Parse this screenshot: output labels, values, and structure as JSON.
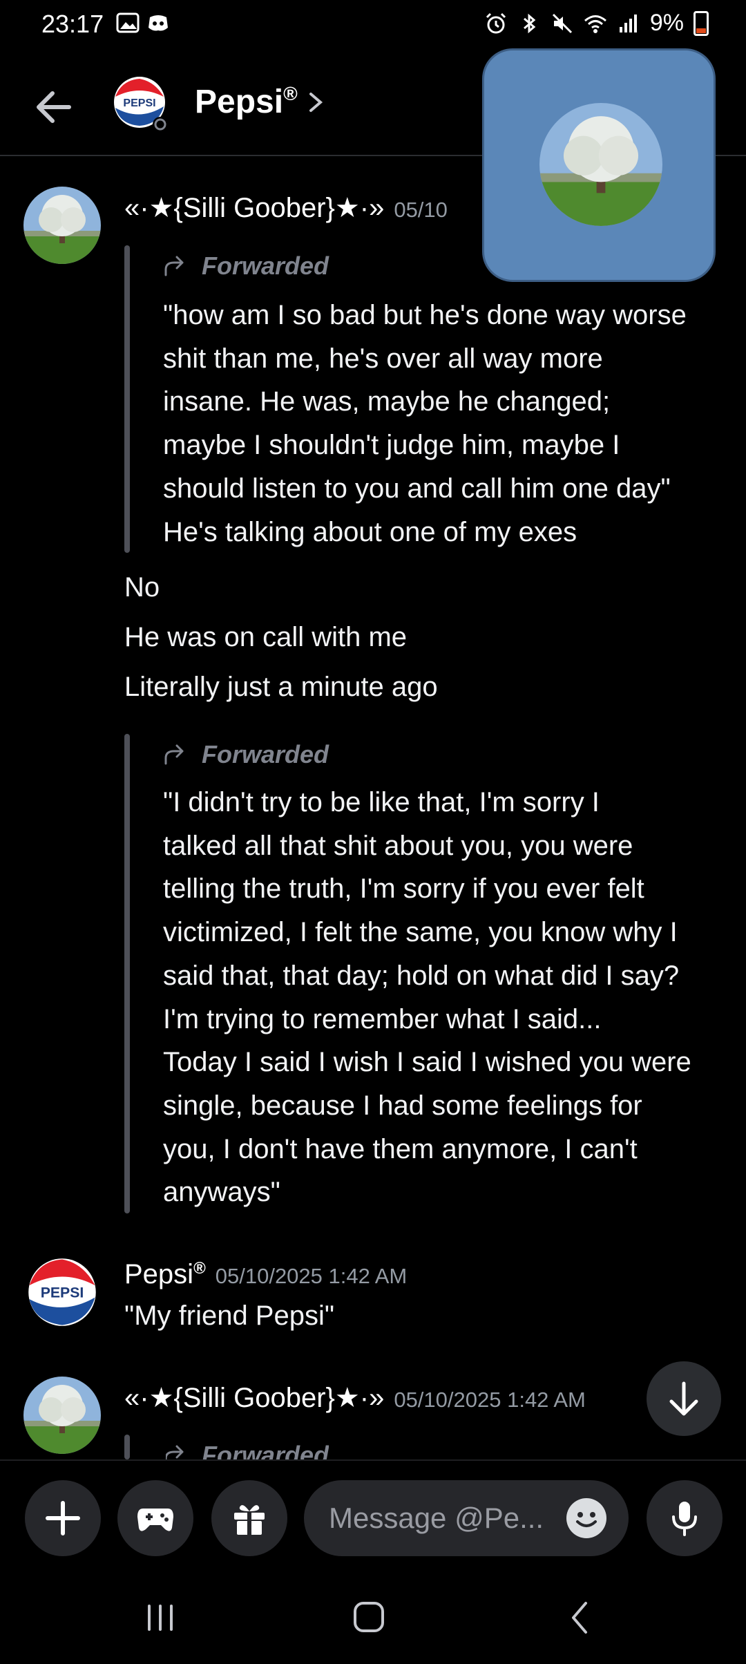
{
  "status_bar": {
    "time": "23:17",
    "battery": "9%"
  },
  "header": {
    "name": "Pepsi",
    "registered": "®",
    "avatar_logo_text": "PEPSI"
  },
  "messages": [
    {
      "author": "«·★{Silli Goober}★·»",
      "timestamp_partial": "05/10",
      "forwarded_label": "Forwarded",
      "forwarded_lines": [
        "\"how am I so bad but he's done way worse",
        "shit than me, he's over all way more",
        "insane. He was, maybe he changed;",
        "maybe I shouldn't judge him, maybe I",
        "should listen to you and call him one day\"",
        "He's talking about one of my exes"
      ],
      "plain_lines": [
        "No",
        "He was on call with me",
        "Literally just a minute ago"
      ],
      "forwarded2_label": "Forwarded",
      "forwarded2_lines": [
        "\"I didn't try to be like that, I'm sorry I",
        "talked all that shit about you, you were",
        "telling the truth, I'm sorry if you ever felt",
        "victimized, I felt the same, you know why I",
        "said that, that day; hold on what did I say?",
        "I'm trying to remember what I said...",
        "Today I said I wish I said I wished you were",
        "single, because I had some feelings for",
        "you, I don't have them anymore, I can't",
        "anyways\""
      ]
    },
    {
      "author": "Pepsi",
      "registered": "®",
      "timestamp": "05/10/2025 1:42 AM",
      "text": "\"My friend Pepsi\""
    },
    {
      "author": "«·★{Silli Goober}★·»",
      "timestamp": "05/10/2025 1:42 AM",
      "forwarded_label": "Forwarded"
    }
  ],
  "composer": {
    "placeholder": "Message @Pe..."
  }
}
